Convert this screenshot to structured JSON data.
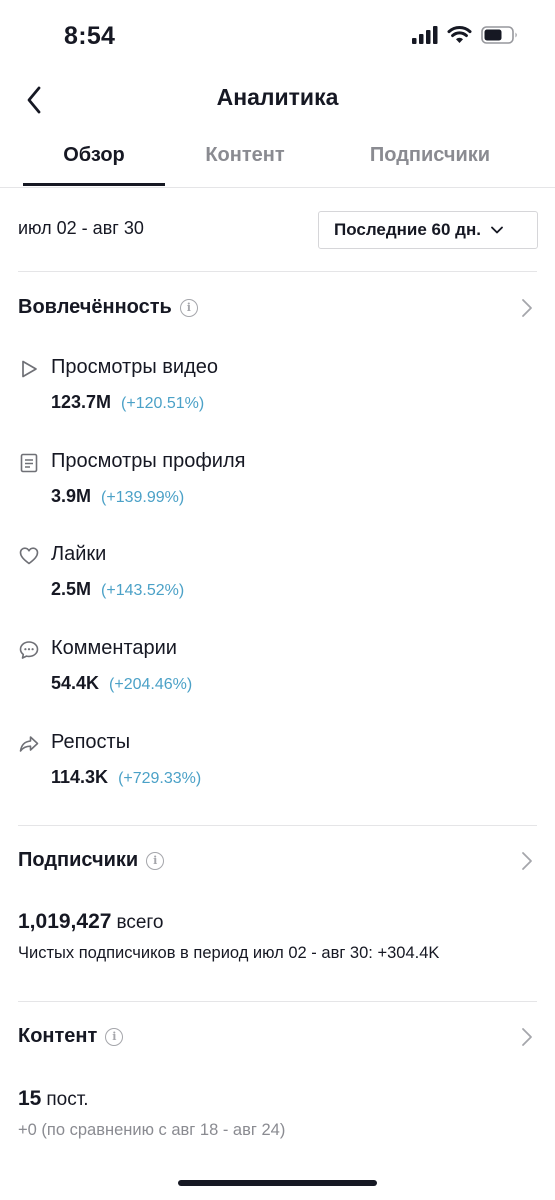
{
  "status_bar": {
    "time": "8:54"
  },
  "header": {
    "title": "Аналитика"
  },
  "tabs": [
    {
      "label": "Обзор",
      "active": true
    },
    {
      "label": "Контент",
      "active": false
    },
    {
      "label": "Подписчики",
      "active": false
    }
  ],
  "date_range": "июл 02 - авг 30",
  "period_select": {
    "label": "Последние 60 дн."
  },
  "engagement": {
    "title": "Вовлечённость",
    "metrics": [
      {
        "icon": "play-icon",
        "label": "Просмотры видео",
        "value": "123.7M",
        "delta": "(+120.51%)"
      },
      {
        "icon": "profile-views-icon",
        "label": "Просмотры профиля",
        "value": "3.9M",
        "delta": "(+139.99%)"
      },
      {
        "icon": "heart-icon",
        "label": "Лайки",
        "value": "2.5M",
        "delta": "(+143.52%)"
      },
      {
        "icon": "comment-icon",
        "label": "Комментарии",
        "value": "54.4K",
        "delta": "(+204.46%)"
      },
      {
        "icon": "share-icon",
        "label": "Репосты",
        "value": "114.3K",
        "delta": "(+729.33%)"
      }
    ]
  },
  "followers": {
    "title": "Подписчики",
    "total": "1,019,427",
    "total_suffix": "всего",
    "net_text": "Чистых подписчиков в период июл 02 - авг 30: +304.4K"
  },
  "content": {
    "title": "Контент",
    "posts": "15",
    "posts_suffix": "пост.",
    "comparison": "+0 (по сравнению с авг 18 - авг 24)"
  },
  "colors": {
    "accent_delta": "#4ba1c7",
    "text": "#161823",
    "muted": "#8a8b91"
  }
}
